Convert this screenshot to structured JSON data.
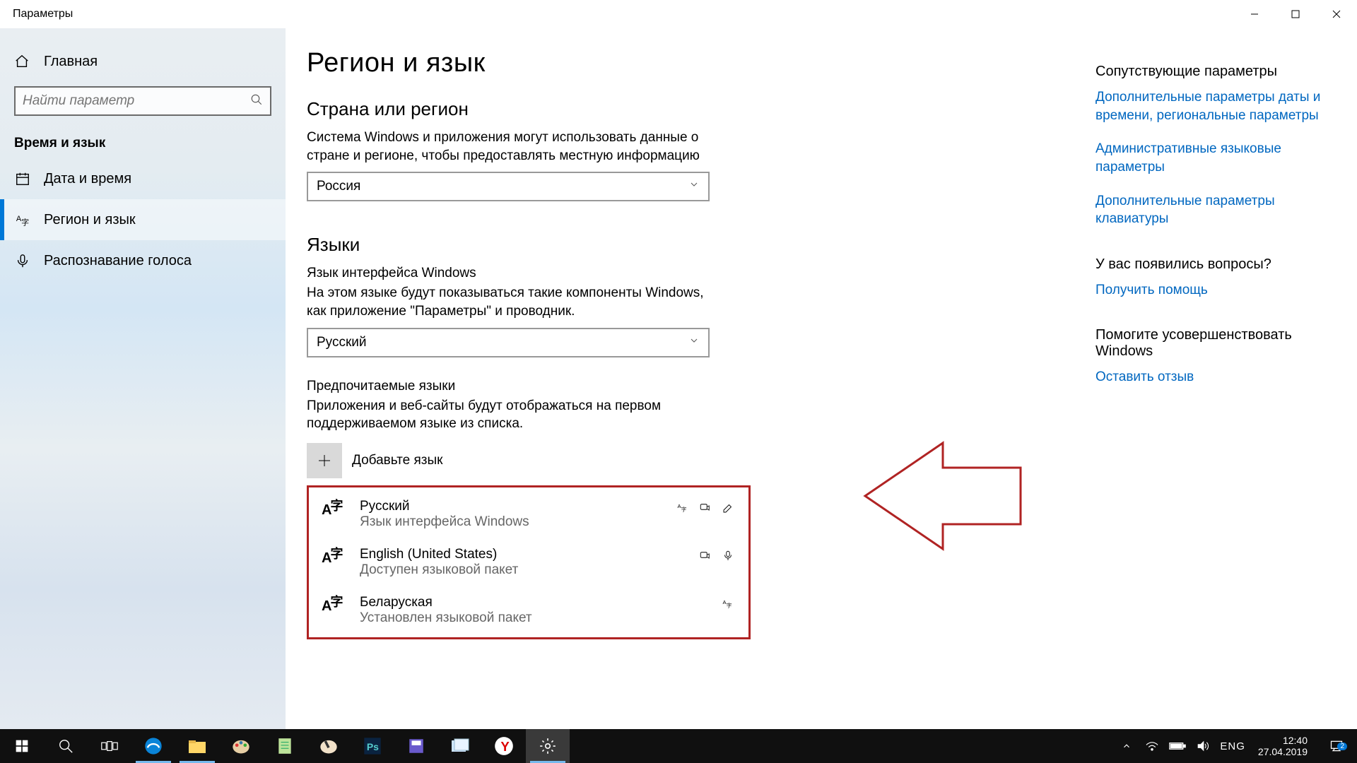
{
  "window": {
    "title": "Параметры"
  },
  "sidebar": {
    "home_label": "Главная",
    "search_placeholder": "Найти параметр",
    "section_title": "Время и язык",
    "items": [
      {
        "label": "Дата и время"
      },
      {
        "label": "Регион и язык"
      },
      {
        "label": "Распознавание голоса"
      }
    ]
  },
  "main": {
    "title": "Регион и язык",
    "country_section": {
      "heading": "Страна или регион",
      "desc": "Система Windows и приложения могут использовать данные о стране и регионе, чтобы предоставлять местную информацию",
      "selected": "Россия"
    },
    "languages_section": {
      "heading": "Языки",
      "ui_lang_label": "Язык интерфейса Windows",
      "ui_lang_desc": "На этом языке будут показываться такие компоненты Windows, как приложение \"Параметры\" и проводник.",
      "ui_lang_selected": "Русский",
      "pref_label": "Предпочитаемые языки",
      "pref_desc": "Приложения и веб-сайты будут отображаться на первом поддерживаемом языке из списка.",
      "add_label": "Добавьте язык",
      "list": [
        {
          "name": "Русский",
          "sub": "Язык интерфейса Windows"
        },
        {
          "name": "English (United States)",
          "sub": "Доступен языковой пакет"
        },
        {
          "name": "Беларуская",
          "sub": "Установлен языковой пакет"
        }
      ]
    }
  },
  "aside": {
    "related_title": "Сопутствующие параметры",
    "links": [
      "Дополнительные параметры даты и времени, региональные параметры",
      "Административные языковые параметры",
      "Дополнительные параметры клавиатуры"
    ],
    "help_title": "У вас появились вопросы?",
    "help_link": "Получить помощь",
    "feedback_title": "Помогите усовершенствовать Windows",
    "feedback_link": "Оставить отзыв"
  },
  "taskbar": {
    "lang": "ENG",
    "time": "12:40",
    "date": "27.04.2019",
    "notification_count": "2"
  }
}
